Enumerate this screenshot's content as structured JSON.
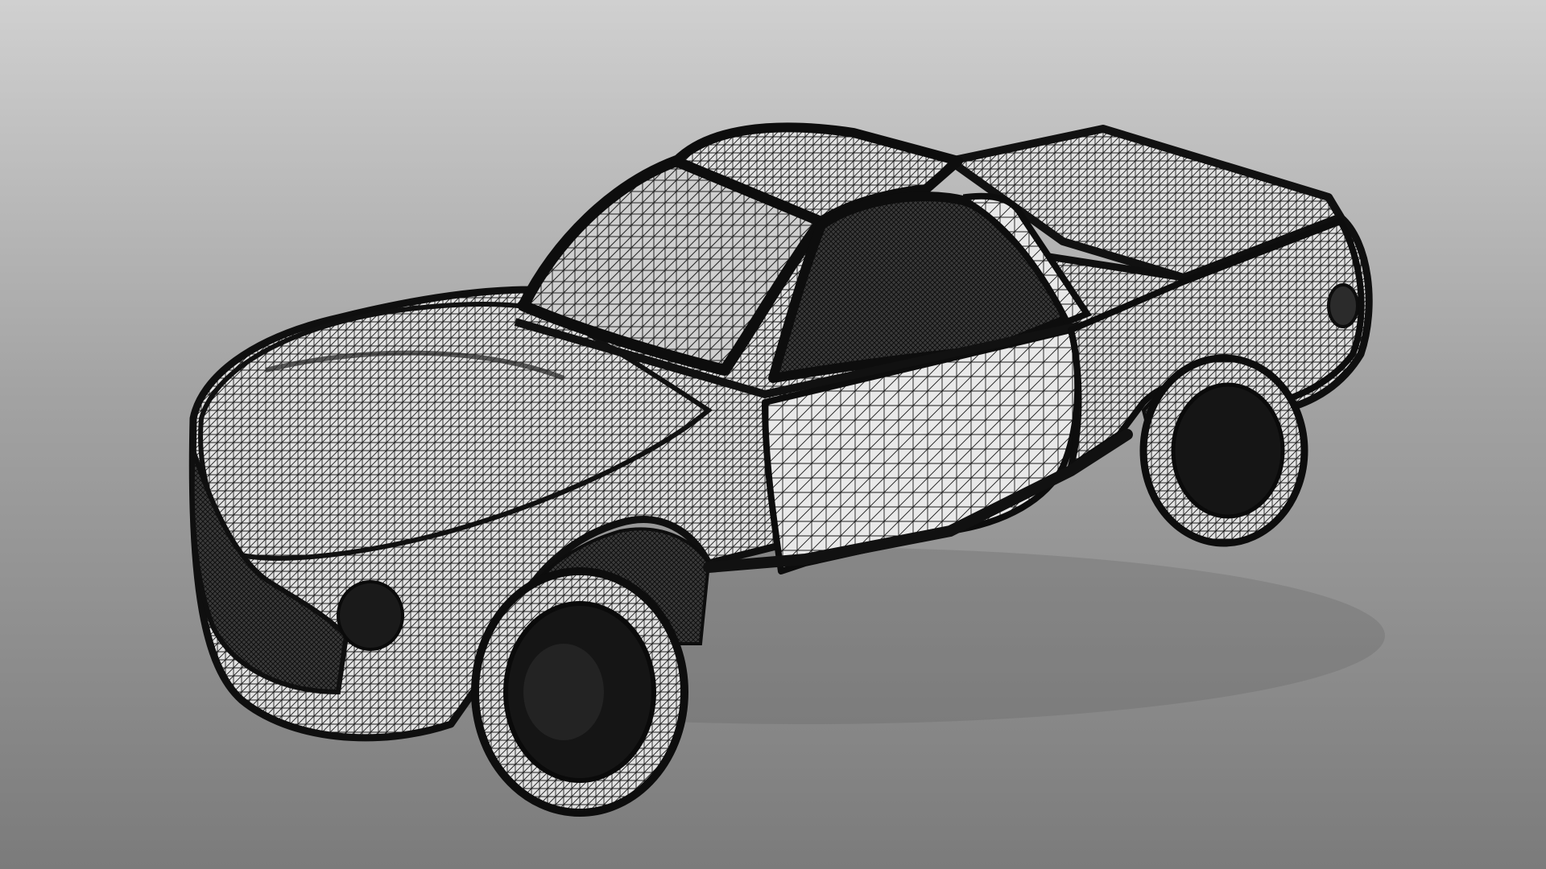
{
  "viewport": {
    "background_top": "#d0d0d0",
    "background_bottom": "#7b7b7b"
  },
  "model": {
    "subject": "car-wireframe-mesh",
    "render_style": "triangle-mesh-wireframe",
    "mesh_color": "#111111",
    "surface_color": "#e6e6e6"
  }
}
